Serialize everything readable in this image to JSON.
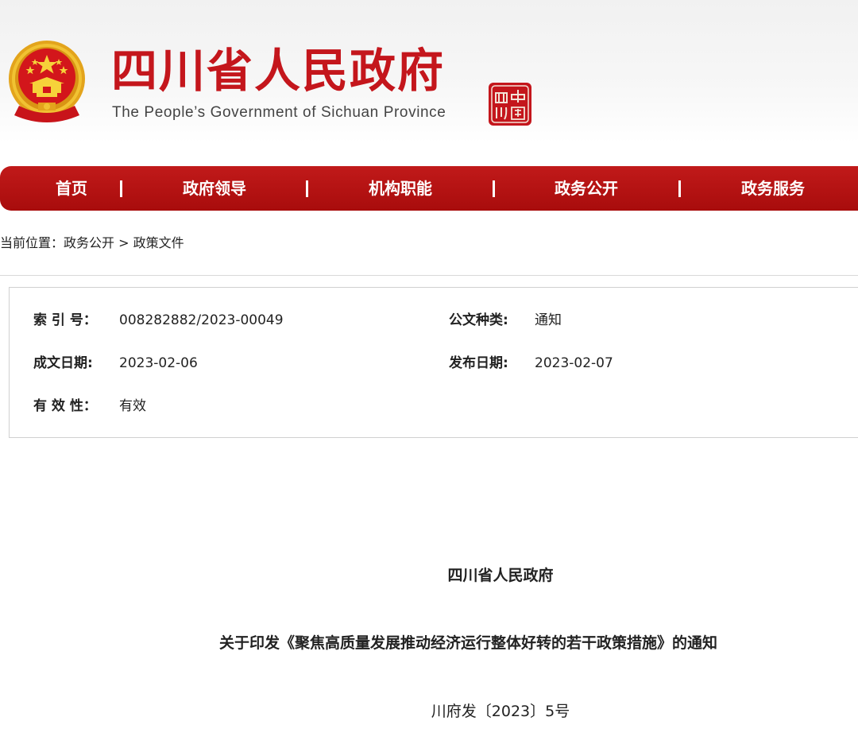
{
  "header": {
    "title": "四川省人民政府",
    "subtitle": "The People’s Government of Sichuan Province",
    "emblem_icon": "national-emblem-icon",
    "seal_icon": "sichuan-seal-icon",
    "seal_text": "四川中國",
    "brand_color": "#c4161c"
  },
  "nav": {
    "background_color": "#b51212",
    "items": [
      {
        "label": "首页"
      },
      {
        "label": "政府领导"
      },
      {
        "label": "机构职能"
      },
      {
        "label": "政务公开"
      },
      {
        "label": "政务服务"
      }
    ],
    "separator": "|"
  },
  "breadcrumb": {
    "prefix": "当前位置：",
    "items": [
      "政务公开",
      "政策文件"
    ],
    "separator": " > "
  },
  "info": {
    "index_label": "索 引 号：",
    "index_value": "008282882/2023-00049",
    "category_label": "公文种类:",
    "category_value": "通知",
    "created_label": "成文日期:",
    "created_value": "2023-02-06",
    "published_label": "发布日期:",
    "published_value": "2023-02-07",
    "validity_label": "有 效 性：",
    "validity_value": "有效"
  },
  "document": {
    "issuer": "四川省人民政府",
    "title": "关于印发《聚焦高质量发展推动经济运行整体好转的若干政策措施》的通知",
    "number": "川府发〔2023〕5号"
  }
}
